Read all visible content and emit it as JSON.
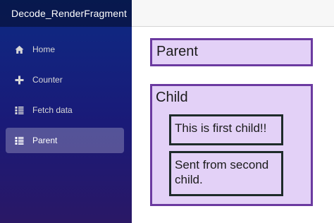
{
  "app": {
    "brand": "Decode_RenderFragment"
  },
  "sidebar": {
    "items": [
      {
        "label": "Home",
        "icon": "home-icon",
        "active": false
      },
      {
        "label": "Counter",
        "icon": "plus-icon",
        "active": false
      },
      {
        "label": "Fetch data",
        "icon": "list-icon",
        "active": false
      },
      {
        "label": "Parent",
        "icon": "list-icon",
        "active": true
      }
    ]
  },
  "main": {
    "parent_label": "Parent",
    "child_label": "Child",
    "first_child_text": "This is first child!!",
    "second_child_text": "Sent from second child."
  },
  "colors": {
    "sidebar_top": "#0d2a83",
    "sidebar_bottom": "#2a1866",
    "box_fill": "#e3d1f7",
    "box_border": "#6b3aa0",
    "inner_border": "#1e2b2a"
  }
}
